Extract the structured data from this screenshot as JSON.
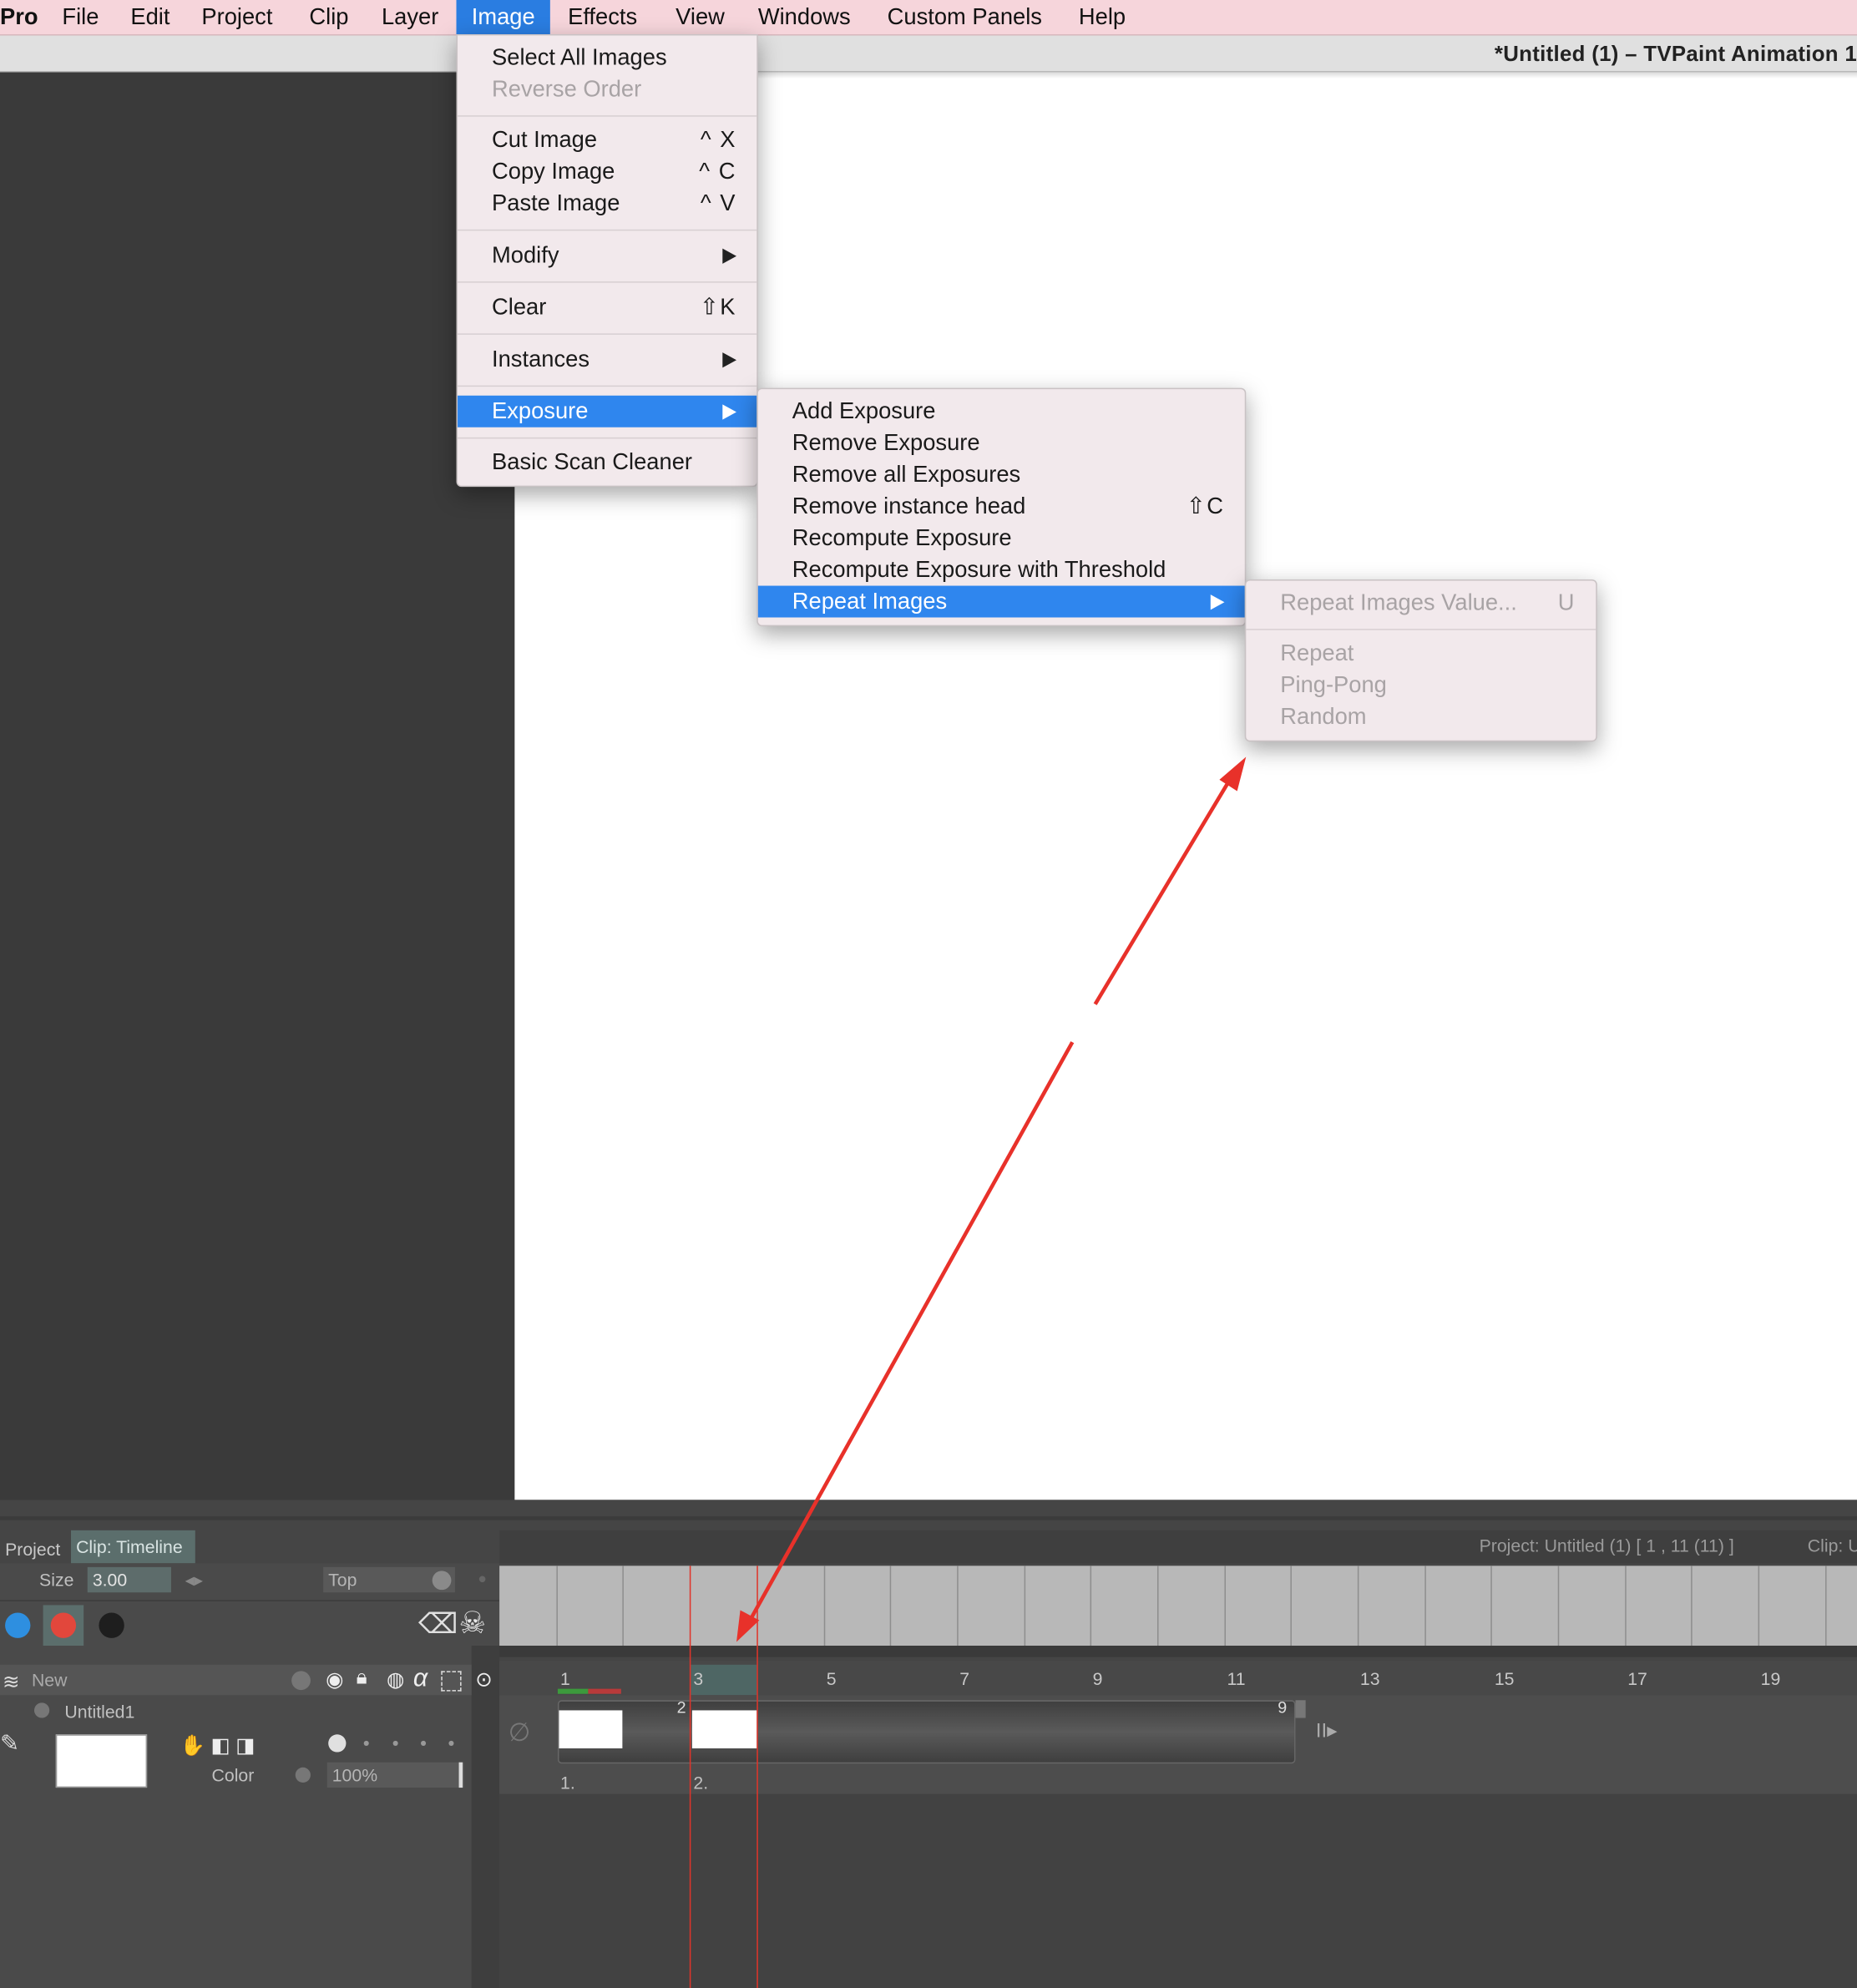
{
  "menubar": {
    "items": [
      "Pro",
      "File",
      "Edit",
      "Project",
      "Clip",
      "Layer",
      "Image",
      "Effects",
      "View",
      "Windows",
      "Custom Panels",
      "Help"
    ],
    "active": "Image"
  },
  "window": {
    "title": "*Untitled (1) – TVPaint Animation 1"
  },
  "image_menu": {
    "select_all": "Select All Images",
    "reverse_order": "Reverse Order",
    "cut": "Cut Image",
    "cut_sc": "^ X",
    "copy": "Copy Image",
    "copy_sc": "^ C",
    "paste": "Paste Image",
    "paste_sc": "^ V",
    "modify": "Modify",
    "clear": "Clear",
    "clear_sc": "⇧K",
    "instances": "Instances",
    "exposure": "Exposure",
    "basic_scan": "Basic Scan Cleaner"
  },
  "exposure_menu": {
    "add": "Add Exposure",
    "remove": "Remove Exposure",
    "remove_all": "Remove all Exposures",
    "remove_head": "Remove instance head",
    "remove_head_sc": "⇧C",
    "recompute": "Recompute Exposure",
    "recompute_threshold": "Recompute Exposure with Threshold",
    "repeat_images": "Repeat Images"
  },
  "repeat_menu": {
    "value": "Repeat Images Value...",
    "value_sc": "U",
    "repeat": "Repeat",
    "ping_pong": "Ping-Pong",
    "random": "Random"
  },
  "timeline": {
    "tabs": [
      "Project",
      "Clip: Timeline"
    ],
    "size_label": "Size",
    "size_value": "3.00",
    "position_value": "Top",
    "project_info": "Project: Untitled (1) [ 1 , 11  (11) ]",
    "clip_info": "Clip: U",
    "new_label": "New",
    "layer_name": "Untitled1",
    "color_label": "Color",
    "opacity": "100%",
    "frame_numbers": [
      "1",
      "3",
      "5",
      "7",
      "9",
      "11",
      "13",
      "15",
      "17",
      "19"
    ],
    "cell_labels": [
      "1.",
      "2."
    ],
    "exposure_marks": [
      "2",
      "9"
    ]
  },
  "colors": {
    "menubar": "#f6d5db",
    "selection": "#2f86ee",
    "annotation_arrow": "#e8312a"
  }
}
